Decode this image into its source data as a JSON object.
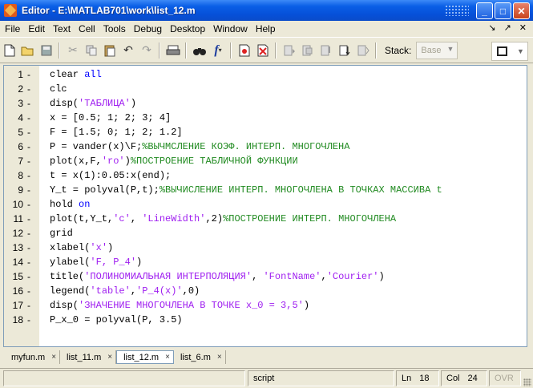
{
  "window": {
    "title": "Editor - E:\\MATLAB701\\work\\list_12.m"
  },
  "menu": [
    "File",
    "Edit",
    "Text",
    "Cell",
    "Tools",
    "Debug",
    "Desktop",
    "Window",
    "Help"
  ],
  "menu_right": {
    "undock": "↘",
    "pin": "↗",
    "close": "✕"
  },
  "toolbar": {
    "stack_label": "Stack:",
    "stack_value": "Base"
  },
  "lines": [
    {
      "n": "1",
      "m": "-"
    },
    {
      "n": "2",
      "m": "-"
    },
    {
      "n": "3",
      "m": "-"
    },
    {
      "n": "4",
      "m": "-"
    },
    {
      "n": "5",
      "m": "-"
    },
    {
      "n": "6",
      "m": "-"
    },
    {
      "n": "7",
      "m": "-"
    },
    {
      "n": "8",
      "m": "-"
    },
    {
      "n": "9",
      "m": "-"
    },
    {
      "n": "10",
      "m": "-"
    },
    {
      "n": "11",
      "m": "-"
    },
    {
      "n": "12",
      "m": "-"
    },
    {
      "n": "13",
      "m": "-"
    },
    {
      "n": "14",
      "m": "-"
    },
    {
      "n": "15",
      "m": "-"
    },
    {
      "n": "16",
      "m": "-"
    },
    {
      "n": "17",
      "m": "-"
    },
    {
      "n": "18",
      "m": "-"
    }
  ],
  "code": {
    "l1": [
      "clear ",
      "all"
    ],
    "l2": "clc",
    "l3": [
      "disp(",
      "'ТАБЛИЦА'",
      ")"
    ],
    "l4": "x = [0.5; 1; 2; 3; 4]",
    "l5": "F = [1.5; 0; 1; 2; 1.2]",
    "l6": [
      "P = vander(x)\\F;",
      "%ВЫЧМСЛЕНИЕ КОЭФ. ИНТЕРП. МНОГОЧЛЕНА"
    ],
    "l7": [
      "plot(x,F,",
      "'ro'",
      ")",
      "%ПОСТРОЕНИЕ ТАБЛИЧНОЙ ФУНКЦИИ"
    ],
    "l8": "t = x(1):0.05:x(end);",
    "l9": [
      "Y_t = polyval(P,t);",
      "%ВЫЧИСЛЕНИЕ ИНТЕРП. МНОГОЧЛЕНА В ТОЧКАХ МАССИВА t"
    ],
    "l10": [
      "hold ",
      "on"
    ],
    "l11": [
      "plot(t,Y_t,",
      "'c'",
      ", ",
      "'LineWidth'",
      ",2)",
      "%ПОСТРОЕНИЕ ИНТЕРП. МНОГОЧЛЕНА"
    ],
    "l12": "grid",
    "l13": [
      "xlabel(",
      "'x'",
      ")"
    ],
    "l14": [
      "ylabel(",
      "'F, P_4'",
      ")"
    ],
    "l15": [
      "title(",
      "'ПОЛИНОМИАЛЬНАЯ ИНТЕРПОЛЯЦИЯ'",
      ", ",
      "'FontName'",
      ",",
      "'Courier'",
      ")"
    ],
    "l16": [
      "legend(",
      "'table'",
      ",",
      "'P_4(x)'",
      ",0)"
    ],
    "l17": [
      "disp(",
      "'ЗНАЧЕНИЕ МНОГОЧЛЕНА В ТОЧКЕ x_0 = 3,5'",
      ")"
    ],
    "l18": "P_x_0 = polyval(P, 3.5)"
  },
  "tabs": [
    {
      "label": "myfun.m",
      "close": "×"
    },
    {
      "label": "list_11.m",
      "close": "×"
    },
    {
      "label": "list_12.m",
      "close": "×"
    },
    {
      "label": "list_6.m",
      "close": "×"
    }
  ],
  "status": {
    "mode": "script",
    "ln_label": "Ln",
    "ln": "18",
    "col_label": "Col",
    "col": "24",
    "ovr": "OVR"
  },
  "colors": {
    "keyword": "#0000ff",
    "string": "#a020f0",
    "comment": "#228b22"
  }
}
